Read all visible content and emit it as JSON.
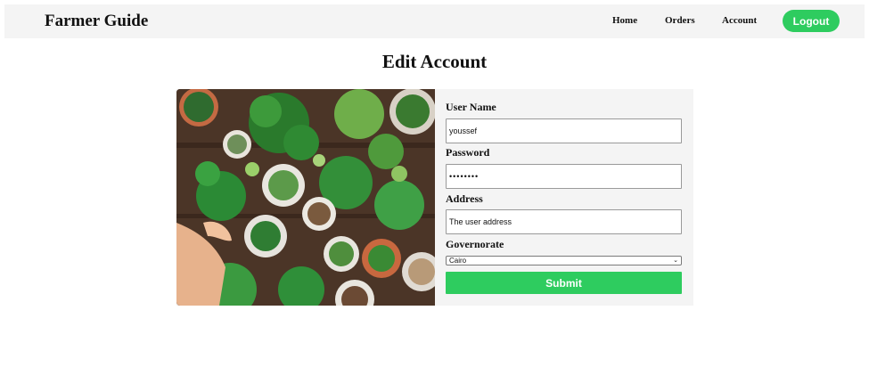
{
  "header": {
    "brand": "Farmer Guide",
    "nav": {
      "home": "Home",
      "orders": "Orders",
      "account": "Account"
    },
    "logout_label": "Logout"
  },
  "page": {
    "title": "Edit Account"
  },
  "form": {
    "username": {
      "label": "User Name",
      "value": "youssef"
    },
    "password": {
      "label": "Password",
      "value": "••••••••"
    },
    "address": {
      "label": "Address",
      "value": "The user address"
    },
    "governorate": {
      "label": "Governorate",
      "selected": "Cairo"
    },
    "submit_label": "Submit"
  },
  "theme": {
    "accent": "#2ecc5f",
    "navbar_bg": "#f4f4f4",
    "card_bg": "#f4f4f4"
  },
  "image": {
    "subject": "potted-houseplants-photo"
  }
}
